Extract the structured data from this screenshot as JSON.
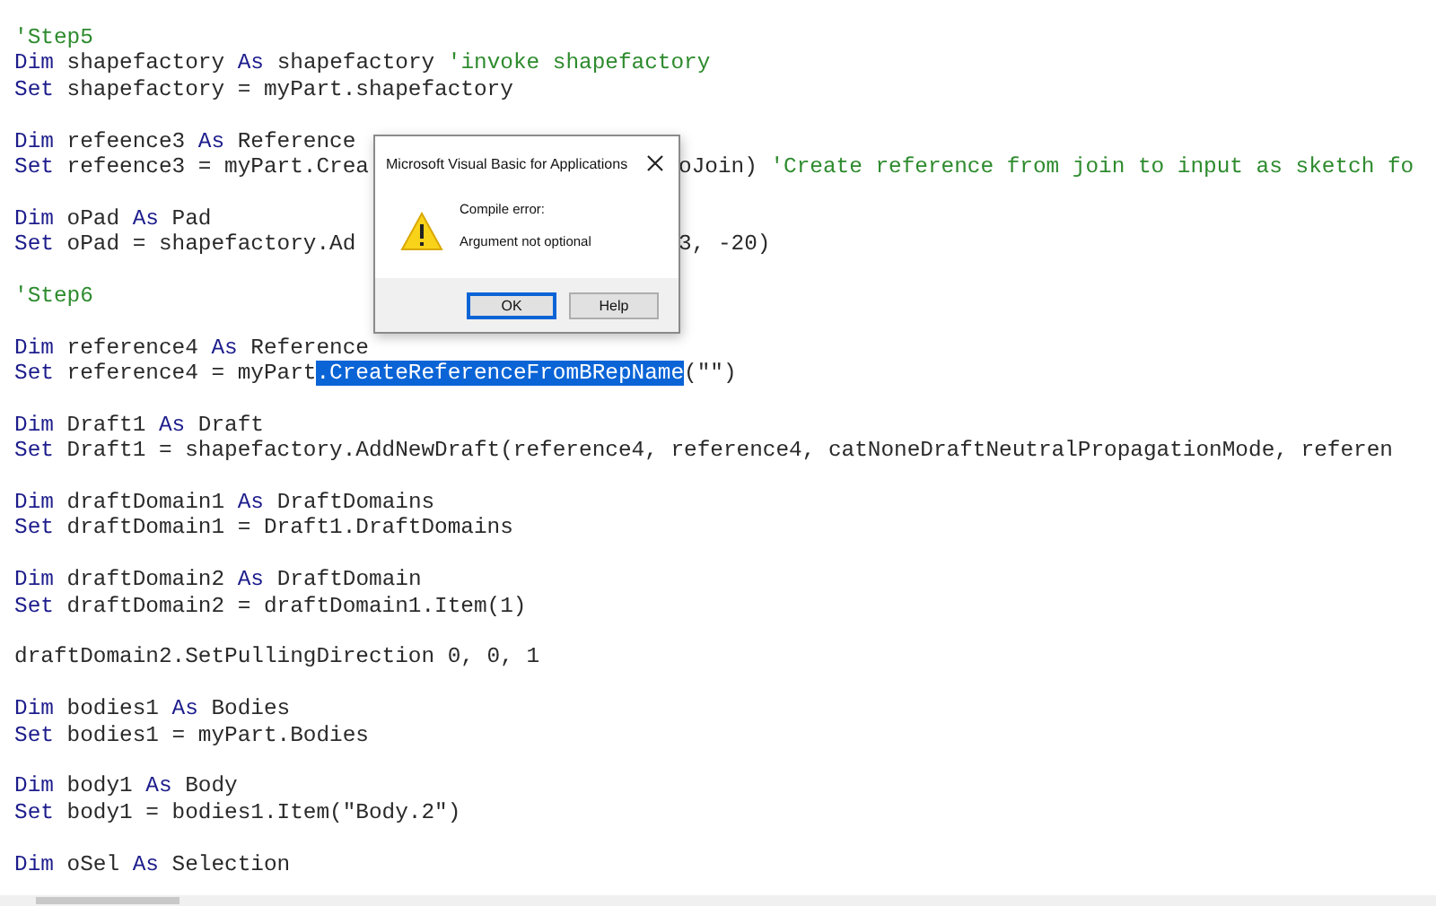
{
  "code": {
    "lines": [
      {
        "kind": "code",
        "tokens": [
          {
            "kind": "comment",
            "text": "'Step5"
          }
        ]
      },
      {
        "kind": "code",
        "tokens": [
          {
            "kind": "keyword",
            "text": "Dim"
          },
          {
            "kind": "plain",
            "text": " shapefactory "
          },
          {
            "kind": "keyword",
            "text": "As"
          },
          {
            "kind": "plain",
            "text": " shapefactory "
          },
          {
            "kind": "comment",
            "text": "'invoke shapefactory"
          }
        ]
      },
      {
        "kind": "code",
        "tokens": [
          {
            "kind": "keyword",
            "text": "Set"
          },
          {
            "kind": "plain",
            "text": " shapefactory = myPart.shapefactory"
          }
        ]
      },
      {
        "kind": "blank"
      },
      {
        "kind": "code",
        "tokens": [
          {
            "kind": "keyword",
            "text": "Dim"
          },
          {
            "kind": "plain",
            "text": " refeence3 "
          },
          {
            "kind": "keyword",
            "text": "As"
          },
          {
            "kind": "plain",
            "text": " Reference"
          }
        ]
      },
      {
        "kind": "code",
        "tokens": [
          {
            "kind": "keyword",
            "text": "Set"
          },
          {
            "kind": "plain",
            "text": " refeence3 = myPart.Crea"
          }
        ],
        "resume": [
          {
            "kind": "plain",
            "text": "oJoin) "
          },
          {
            "kind": "comment",
            "text": "'Create reference from join to input as sketch fo"
          }
        ]
      },
      {
        "kind": "blank"
      },
      {
        "kind": "code",
        "tokens": [
          {
            "kind": "keyword",
            "text": "Dim"
          },
          {
            "kind": "plain",
            "text": " oPad "
          },
          {
            "kind": "keyword",
            "text": "As"
          },
          {
            "kind": "plain",
            "text": " Pad"
          }
        ]
      },
      {
        "kind": "code",
        "tokens": [
          {
            "kind": "keyword",
            "text": "Set"
          },
          {
            "kind": "plain",
            "text": " oPad = shapefactory.Ad"
          }
        ],
        "resume": [
          {
            "kind": "plain",
            "text": "3, -20)"
          }
        ]
      },
      {
        "kind": "blank"
      },
      {
        "kind": "code",
        "tokens": [
          {
            "kind": "comment",
            "text": "'Step6"
          }
        ]
      },
      {
        "kind": "blank"
      },
      {
        "kind": "code",
        "tokens": [
          {
            "kind": "keyword",
            "text": "Dim"
          },
          {
            "kind": "plain",
            "text": " reference4 "
          },
          {
            "kind": "keyword",
            "text": "As"
          },
          {
            "kind": "plain",
            "text": " Reference"
          }
        ]
      },
      {
        "kind": "code",
        "tokens": [
          {
            "kind": "keyword",
            "text": "Set"
          },
          {
            "kind": "plain",
            "text": " reference4 = myPart"
          },
          {
            "kind": "selected",
            "text": ".CreateReferenceFromBRepName"
          },
          {
            "kind": "plain",
            "text": "(\"\")"
          }
        ]
      },
      {
        "kind": "blank"
      },
      {
        "kind": "code",
        "tokens": [
          {
            "kind": "keyword",
            "text": "Dim"
          },
          {
            "kind": "plain",
            "text": " Draft1 "
          },
          {
            "kind": "keyword",
            "text": "As"
          },
          {
            "kind": "plain",
            "text": " Draft"
          }
        ]
      },
      {
        "kind": "code",
        "tokens": [
          {
            "kind": "keyword",
            "text": "Set"
          },
          {
            "kind": "plain",
            "text": " Draft1 = shapefactory.AddNewDraft(reference4, reference4, catNoneDraftNeutralPropagationMode, referen"
          }
        ]
      },
      {
        "kind": "blank"
      },
      {
        "kind": "code",
        "tokens": [
          {
            "kind": "keyword",
            "text": "Dim"
          },
          {
            "kind": "plain",
            "text": " draftDomain1 "
          },
          {
            "kind": "keyword",
            "text": "As"
          },
          {
            "kind": "plain",
            "text": " DraftDomains"
          }
        ]
      },
      {
        "kind": "code",
        "tokens": [
          {
            "kind": "keyword",
            "text": "Set"
          },
          {
            "kind": "plain",
            "text": " draftDomain1 = Draft1.DraftDomains"
          }
        ]
      },
      {
        "kind": "blank"
      },
      {
        "kind": "code",
        "tokens": [
          {
            "kind": "keyword",
            "text": "Dim"
          },
          {
            "kind": "plain",
            "text": " draftDomain2 "
          },
          {
            "kind": "keyword",
            "text": "As"
          },
          {
            "kind": "plain",
            "text": " DraftDomain"
          }
        ]
      },
      {
        "kind": "code",
        "tokens": [
          {
            "kind": "keyword",
            "text": "Set"
          },
          {
            "kind": "plain",
            "text": " draftDomain2 = draftDomain1.Item(1)"
          }
        ]
      },
      {
        "kind": "blank"
      },
      {
        "kind": "code",
        "tokens": [
          {
            "kind": "plain",
            "text": "draftDomain2.SetPullingDirection 0, 0, 1"
          }
        ]
      },
      {
        "kind": "blank"
      },
      {
        "kind": "code",
        "tokens": [
          {
            "kind": "keyword",
            "text": "Dim"
          },
          {
            "kind": "plain",
            "text": " bodies1 "
          },
          {
            "kind": "keyword",
            "text": "As"
          },
          {
            "kind": "plain",
            "text": " Bodies"
          }
        ]
      },
      {
        "kind": "code",
        "tokens": [
          {
            "kind": "keyword",
            "text": "Set"
          },
          {
            "kind": "plain",
            "text": " bodies1 = myPart.Bodies"
          }
        ]
      },
      {
        "kind": "blank"
      },
      {
        "kind": "code",
        "tokens": [
          {
            "kind": "keyword",
            "text": "Dim"
          },
          {
            "kind": "plain",
            "text": " body1 "
          },
          {
            "kind": "keyword",
            "text": "As"
          },
          {
            "kind": "plain",
            "text": " Body"
          }
        ]
      },
      {
        "kind": "code",
        "tokens": [
          {
            "kind": "keyword",
            "text": "Set"
          },
          {
            "kind": "plain",
            "text": " body1 = bodies1.Item(\"Body.2\")"
          }
        ]
      },
      {
        "kind": "blank"
      },
      {
        "kind": "code",
        "tokens": [
          {
            "kind": "keyword",
            "text": "Dim"
          },
          {
            "kind": "plain",
            "text": " oSel "
          },
          {
            "kind": "keyword",
            "text": "As"
          },
          {
            "kind": "plain",
            "text": " Selection"
          }
        ]
      }
    ]
  },
  "dialog": {
    "title": "Microsoft Visual Basic for Applications",
    "heading": "Compile error:",
    "message": "Argument not optional",
    "buttons": [
      {
        "label": "OK",
        "selected": true
      },
      {
        "label": "Help",
        "selected": false
      }
    ]
  }
}
